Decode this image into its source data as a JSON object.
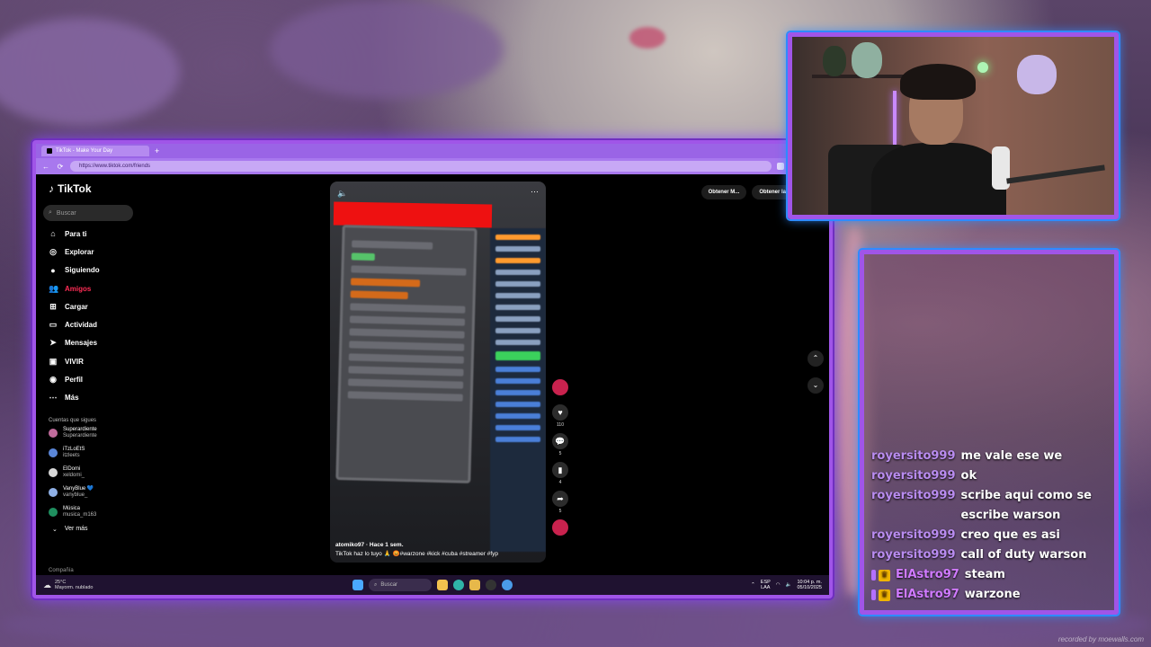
{
  "browser": {
    "tab_title": "TikTok - Make Your Day",
    "url": "https://www.tiktok.com/friends"
  },
  "tiktok": {
    "logo": "TikTok",
    "search_placeholder": "Buscar",
    "nav": [
      {
        "label": "Para ti",
        "icon": "home-icon"
      },
      {
        "label": "Explorar",
        "icon": "compass-icon"
      },
      {
        "label": "Siguiendo",
        "icon": "following-icon"
      },
      {
        "label": "Amigos",
        "icon": "friends-icon"
      },
      {
        "label": "Cargar",
        "icon": "upload-icon"
      },
      {
        "label": "Actividad",
        "icon": "activity-icon"
      },
      {
        "label": "Mensajes",
        "icon": "messages-icon"
      },
      {
        "label": "VIVIR",
        "icon": "live-icon"
      },
      {
        "label": "Perfil",
        "icon": "profile-icon"
      },
      {
        "label": "Más",
        "icon": "more-icon"
      }
    ],
    "following_title": "Cuentas que sigues",
    "accounts": [
      {
        "name": "Superardiente",
        "handle": "Superardiente"
      },
      {
        "name": "iTzLoEtS",
        "handle": "itzleets"
      },
      {
        "name": "ElDomi",
        "handle": "xeldomi_"
      },
      {
        "name": "VanyBlue 💙",
        "handle": "vanyblue_"
      },
      {
        "name": "Música",
        "handle": "musica_m163"
      }
    ],
    "see_more": "Ver más",
    "company": "Compañía",
    "get_app_1": "Obtener M...",
    "get_app_2": "Obtener la",
    "video": {
      "caption": "atomiko97 · Hace 1 sem.",
      "description": "TikTok haz lo tuyo 🙏 😡#warzone #kick #cuba #streamer #fyp"
    },
    "actions": {
      "likes": "110",
      "comments": "5",
      "saves": "4",
      "shares": "5"
    }
  },
  "taskbar": {
    "weather_temp": "25°C",
    "weather_desc": "Mayorm. nublado",
    "search": "Buscar",
    "lang1": "ESP",
    "lang2": "LAA",
    "time": "10:04 p. m.",
    "date": "05/10/2025"
  },
  "chat": {
    "messages": [
      {
        "user": "royersito999",
        "text": "me vale ese we",
        "badges": false
      },
      {
        "user": "royersito999",
        "text": "ok",
        "badges": false
      },
      {
        "user": "royersito999",
        "text": "scribe aqui como se escribe warson",
        "badges": false
      },
      {
        "user": "royersito999",
        "text": "creo que es asi",
        "badges": false
      },
      {
        "user": "royersito999",
        "text": "call of duty warson",
        "badges": false
      },
      {
        "user": "ElAstro97",
        "text": "steam",
        "badges": true
      },
      {
        "user": "ElAstro97",
        "text": "warzone",
        "badges": true
      }
    ]
  },
  "watermark": "recorded by moewalls.com"
}
